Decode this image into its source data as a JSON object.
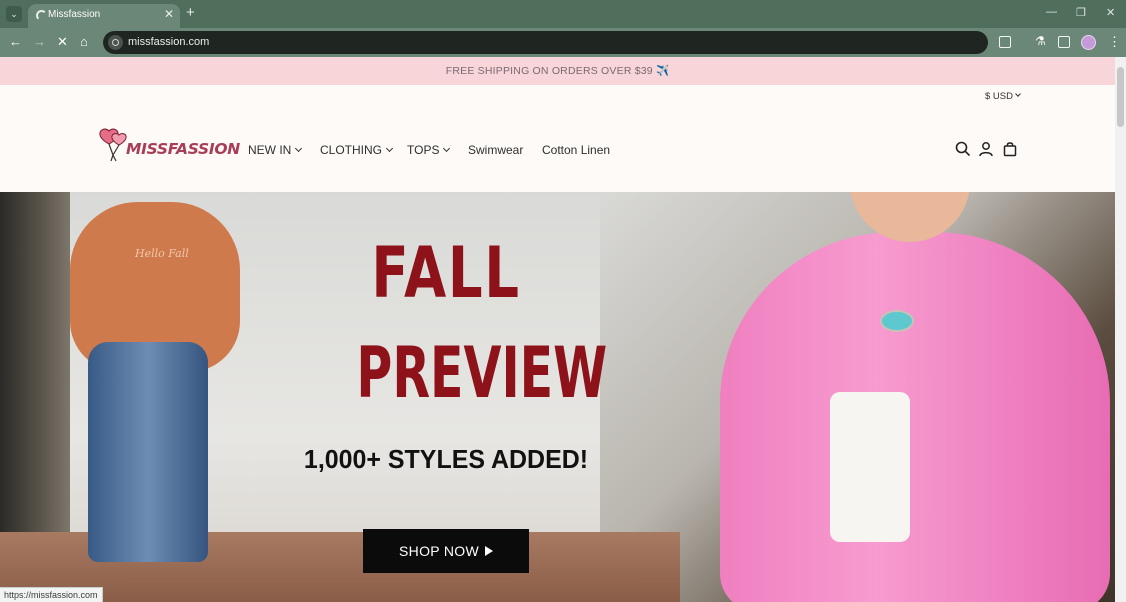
{
  "browser": {
    "tab_title": "Missfassion",
    "url": "missfassion.com",
    "status_url": "https://missfassion.com"
  },
  "announcement": "FREE SHIPPING ON ORDERS OVER $39 ✈️",
  "currency": "$ USD",
  "logo_text": "MISSFASSION",
  "nav": {
    "items": [
      {
        "label": "NEW IN",
        "dropdown": true
      },
      {
        "label": "CLOTHING",
        "dropdown": true
      },
      {
        "label": "TOPS",
        "dropdown": true
      },
      {
        "label": "Swimwear",
        "dropdown": false
      },
      {
        "label": "Cotton Linen",
        "dropdown": false
      }
    ]
  },
  "hero": {
    "line1": "FALL",
    "line2": "PREVIEW",
    "subtitle": "1,000+ STYLES ADDED!",
    "button": "SHOP NOW",
    "sweatshirt_text": "Hello Fall"
  },
  "colors": {
    "announcement_bg": "#f7d5d9",
    "hero_title": "#8e1219",
    "browser_chrome": "#6b8777",
    "logo": "#a83e55"
  }
}
